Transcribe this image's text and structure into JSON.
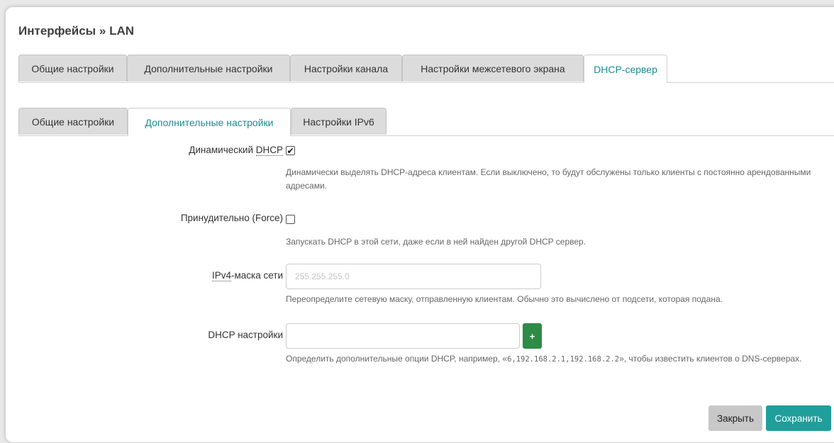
{
  "title": "Интерфейсы » LAN",
  "main_tabs": [
    {
      "label": "Общие настройки"
    },
    {
      "label": "Дополнительные настройки"
    },
    {
      "label": "Настройки канала"
    },
    {
      "label": "Настройки межсетевого экрана"
    },
    {
      "label": "DHCP-сервер"
    }
  ],
  "sub_tabs": [
    {
      "label": "Общие настройки"
    },
    {
      "label": "Дополнительные настройки"
    },
    {
      "label": "Настройки IPv6"
    }
  ],
  "dynamic_dhcp": {
    "label_prefix": "Динамический ",
    "label_abbr": "DHCP",
    "checked": true,
    "check_glyph": "✔",
    "help": "Динамически выделять DHCP-адреса клиентам. Если выключено, то будут обслужены только клиенты с постоянно арендованными адресами."
  },
  "force": {
    "label": "Принудительно (Force)",
    "checked": false,
    "help": "Запускать DHCP в этой сети, даже если в ней найден другой DHCP сервер."
  },
  "netmask": {
    "label_abbr": "IPv4",
    "label_suffix": "-маска сети",
    "placeholder": "255.255.255.0",
    "value": "",
    "help": "Переопределите сетевую маску, отправленную клиентам. Обычно это вычислено от подсети, которая подана."
  },
  "dhcp_options": {
    "label": "DHCP настройки",
    "value": "",
    "add_label": "+",
    "help_prefix": "Определить дополнительные опции DHCP, например, «",
    "help_code": "6,192.168.2.1,192.168.2.2",
    "help_suffix": "», чтобы известить клиентов о DNS-серверах."
  },
  "buttons": {
    "close": "Закрыть",
    "save": "Сохранить"
  },
  "colors": {
    "accent": "#1f9e9c",
    "add_button": "#2e8b46",
    "active_tab_text": "#1b8d8f"
  }
}
